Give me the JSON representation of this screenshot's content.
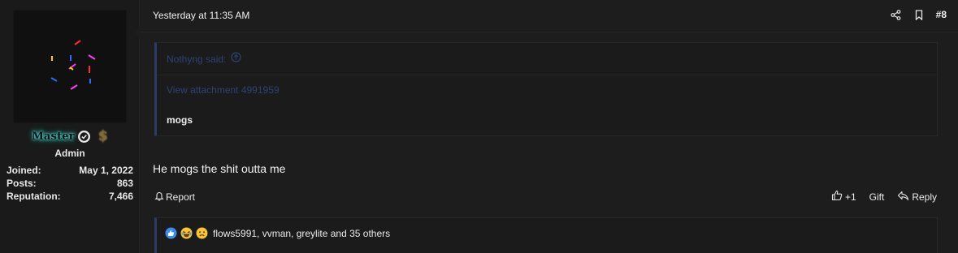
{
  "author": {
    "username": "Master",
    "role": "Admin",
    "stats": [
      {
        "label": "Joined:",
        "value": "May 1, 2022"
      },
      {
        "label": "Posts:",
        "value": "863"
      },
      {
        "label": "Reputation:",
        "value": "7,466"
      }
    ],
    "name_glow_color": "#3fd9d0"
  },
  "post": {
    "timestamp": "Yesterday at 11:35 AM",
    "number": "#8",
    "quote": {
      "author_label": "Nothyng said:",
      "attachment_label": "View attachment 4991959",
      "text": "mogs"
    },
    "message": "He mogs the shit outta me",
    "actions": {
      "report": "Report",
      "like": "+1",
      "gift": "Gift",
      "reply": "Reply"
    },
    "reactions": {
      "icons": [
        "like-icon",
        "laugh-icon",
        "sad-icon"
      ],
      "users_text": "flows5991, vvman, greylite and 35 others"
    }
  },
  "colors": {
    "background": "#1d1d1d",
    "quote_accent": "#2a3b68",
    "link": "#2f4275"
  }
}
